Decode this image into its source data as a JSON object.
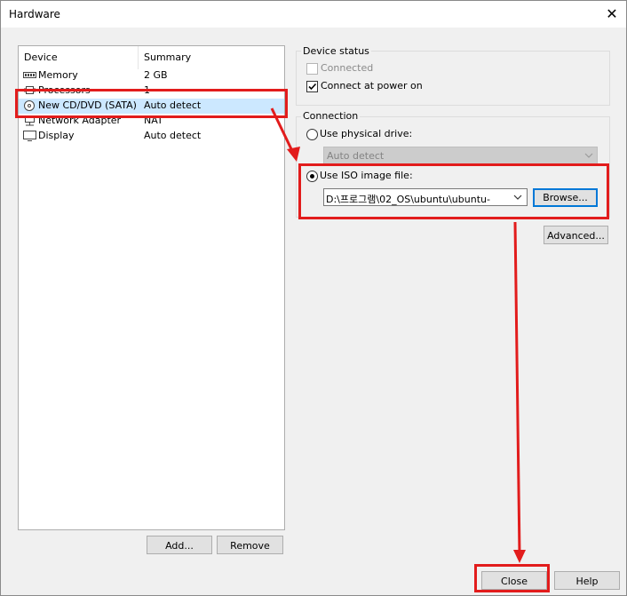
{
  "window": {
    "title": "Hardware"
  },
  "device_list": {
    "headers": {
      "device": "Device",
      "summary": "Summary"
    },
    "rows": [
      {
        "device": "Memory",
        "summary": "2 GB",
        "icon": "memory-icon"
      },
      {
        "device": "Processors",
        "summary": "1",
        "icon": "processor-icon"
      },
      {
        "device": "New CD/DVD (SATA)",
        "summary": "Auto detect",
        "icon": "cd-dvd-icon",
        "selected": true
      },
      {
        "device": "Network Adapter",
        "summary": "NAT",
        "icon": "network-adapter-icon"
      },
      {
        "device": "Display",
        "summary": "Auto detect",
        "icon": "display-icon"
      }
    ],
    "add_label": "Add...",
    "remove_label": "Remove"
  },
  "device_status": {
    "label": "Device status",
    "connected_label": "Connected",
    "connected_checked": false,
    "connect_power_label": "Connect at power on",
    "connect_power_checked": true
  },
  "connection": {
    "label": "Connection",
    "physical_label": "Use physical drive:",
    "physical_value": "Auto detect",
    "iso_label": "Use ISO image file:",
    "iso_value": "D:\\프로그램\\02_OS\\ubuntu\\ubuntu-",
    "browse_label": "Browse...",
    "selected": "iso"
  },
  "advanced_label": "Advanced...",
  "footer": {
    "close_label": "Close",
    "help_label": "Help"
  },
  "colors": {
    "annotation_red": "#e21c1c",
    "selection_bg": "#cce8ff",
    "focus_border": "#0078d7"
  }
}
